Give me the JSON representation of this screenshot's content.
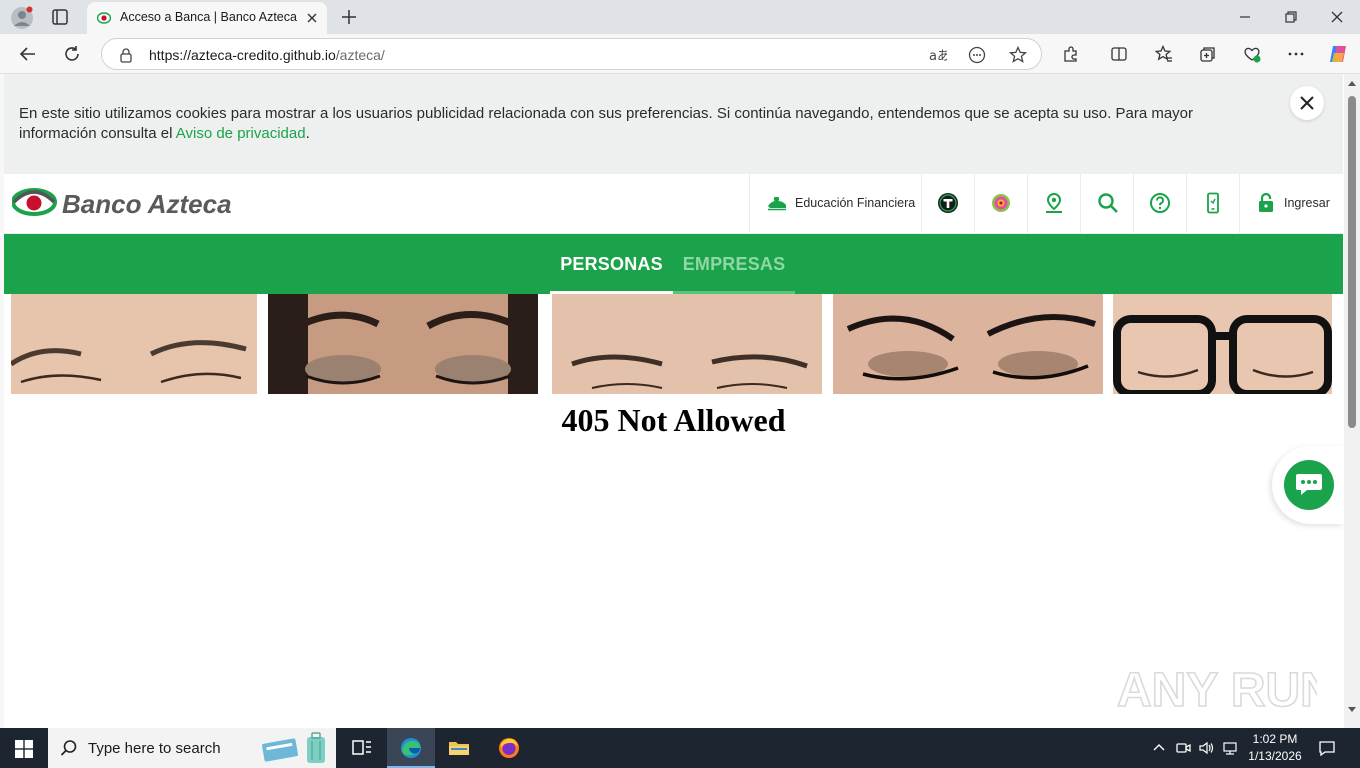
{
  "browser": {
    "tab_title": "Acceso a Banca | Banco Azteca",
    "url_host": "https://azteca-credito.github.io",
    "url_path": "/azteca/"
  },
  "cookie_banner": {
    "text": "En este sitio utilizamos cookies para mostrar a los usuarios publicidad relacionada con sus preferencias. Si continúa navegando, entendemos que se acepta su uso. Para mayor información consulta el ",
    "link_text": "Aviso de privacidad",
    "trailing": "."
  },
  "header": {
    "brand": "Banco Azteca",
    "education_label": "Educación Financiera",
    "login_label": "Ingresar"
  },
  "segments": {
    "personas": "PERSONAS",
    "empresas": "EMPRESAS"
  },
  "main": {
    "error_title": "405 Not Allowed"
  },
  "watermark": "ANY RUN",
  "taskbar": {
    "search_placeholder": "Type here to search",
    "time": "1:02 PM",
    "date": "1/13/2026"
  },
  "colors": {
    "brand_green": "#1aa34a",
    "brand_red": "#c8102e",
    "link_green": "#1aa34a"
  },
  "icons": [
    "profile-icon",
    "tab-actions-icon",
    "favicon-icon",
    "close-icon",
    "plus-icon",
    "back-icon",
    "refresh-icon",
    "lock-icon",
    "read-aloud-icon",
    "emoji-icon",
    "star-icon",
    "extensions-icon",
    "split-screen-icon",
    "favorites-icon",
    "collections-icon",
    "performance-icon",
    "more-icon",
    "copilot-icon",
    "piggy-bank-icon",
    "tienda-icon",
    "app-icon",
    "location-icon",
    "search-icon",
    "help-icon",
    "phone-icon",
    "padlock-icon",
    "chat-icon",
    "windows-icon",
    "taskview-icon",
    "edge-icon",
    "folder-icon",
    "firefox-icon"
  ]
}
